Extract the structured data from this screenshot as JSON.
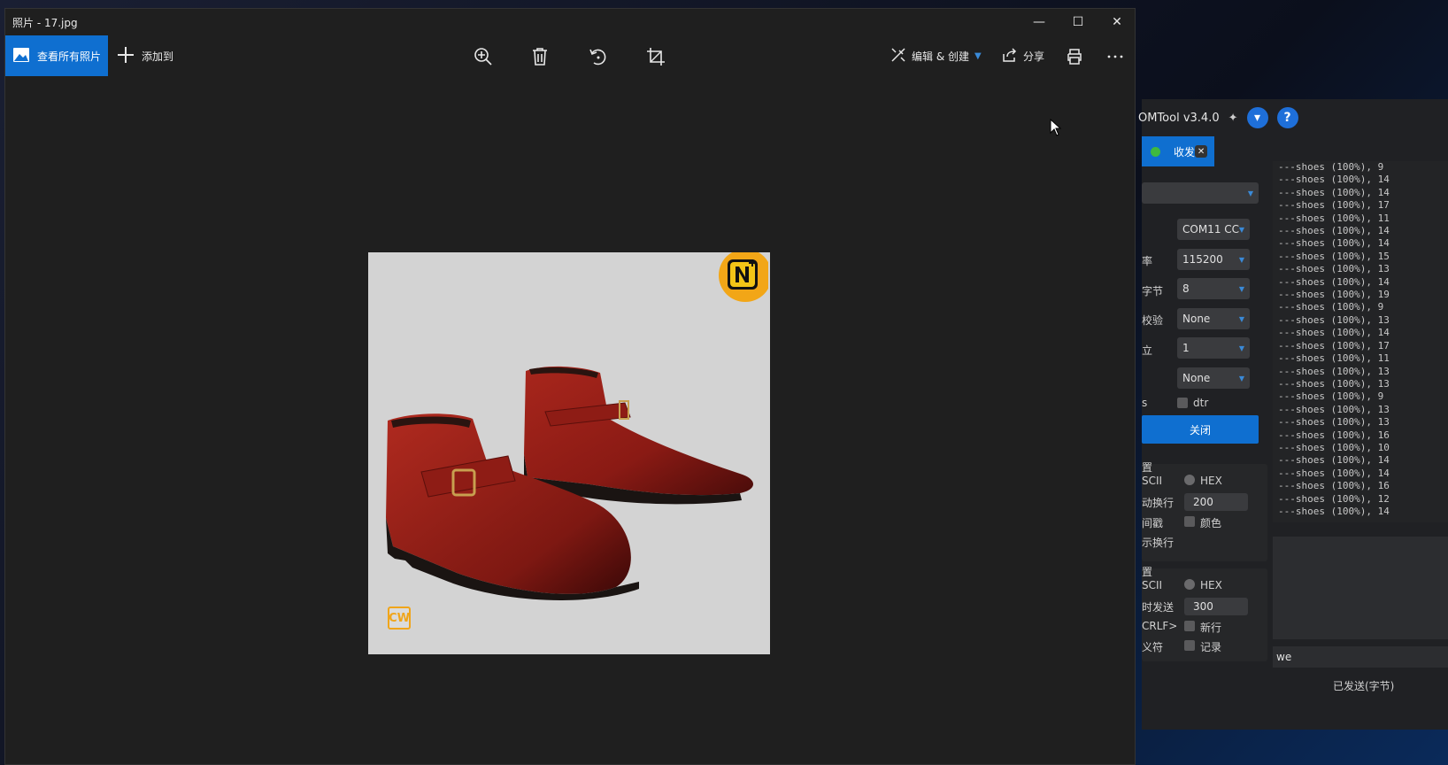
{
  "photos": {
    "title": "照片 - 17.jpg",
    "toolbar": {
      "view_all": "查看所有照片",
      "add_to": "添加到",
      "edit_create": "编辑 & 创建",
      "share": "分享"
    },
    "image": {
      "watermark_cw": "CW"
    }
  },
  "comtool": {
    "title": "OMTool v3.4.0",
    "tab": "收发",
    "settings": {
      "port_value": "COM11 CC",
      "baud_label": "率",
      "baud_value": "115200",
      "bytesize_label": "字节",
      "bytesize_value": "8",
      "parity_label": "校验",
      "parity_value": "None",
      "stopbits_label": "立",
      "stopbits_value": "1",
      "flow_value": "None",
      "rts_label": "s",
      "dtr_label": "dtr",
      "close_button": "关闭"
    },
    "receive": {
      "group_label": "置",
      "ascii_label": "SCII",
      "hex_label": "HEX",
      "autowrap_label": "动换行",
      "autowrap_value": "200",
      "timestamp_label": "间戳",
      "color_label": "颜色",
      "showwrap_label": "示换行"
    },
    "send": {
      "group_label": "置",
      "ascii_label": "SCII",
      "hex_label": "HEX",
      "timer_label": "时发送",
      "timer_value": "300",
      "crlf_label": "CRLF>",
      "newline_label": "新行",
      "escape_label": "义符",
      "record_label": "记录",
      "input_value": "we",
      "sent_label": "已发送(字节)"
    },
    "log_lines": [
      "---shoes (100%), 9",
      "---shoes (100%), 14",
      "---shoes (100%), 14",
      "---shoes (100%), 17",
      "---shoes (100%), 11",
      "---shoes (100%), 14",
      "---shoes (100%), 14",
      "---shoes (100%), 15",
      "---shoes (100%), 13",
      "---shoes (100%), 14",
      "---shoes (100%), 19",
      "---shoes (100%), 9",
      "---shoes (100%), 13",
      "---shoes (100%), 14",
      "---shoes (100%), 17",
      "---shoes (100%), 11",
      "---shoes (100%), 13",
      "---shoes (100%), 13",
      "---shoes (100%), 9",
      "---shoes (100%), 13",
      "---shoes (100%), 13",
      "---shoes (100%), 16",
      "---shoes (100%), 10",
      "---shoes (100%), 14",
      "---shoes (100%), 14",
      "---shoes (100%), 16",
      "---shoes (100%), 12",
      "---shoes (100%), 14"
    ]
  },
  "colors": {
    "accent": "#0f6fd0",
    "status_green": "#3fb93f"
  }
}
